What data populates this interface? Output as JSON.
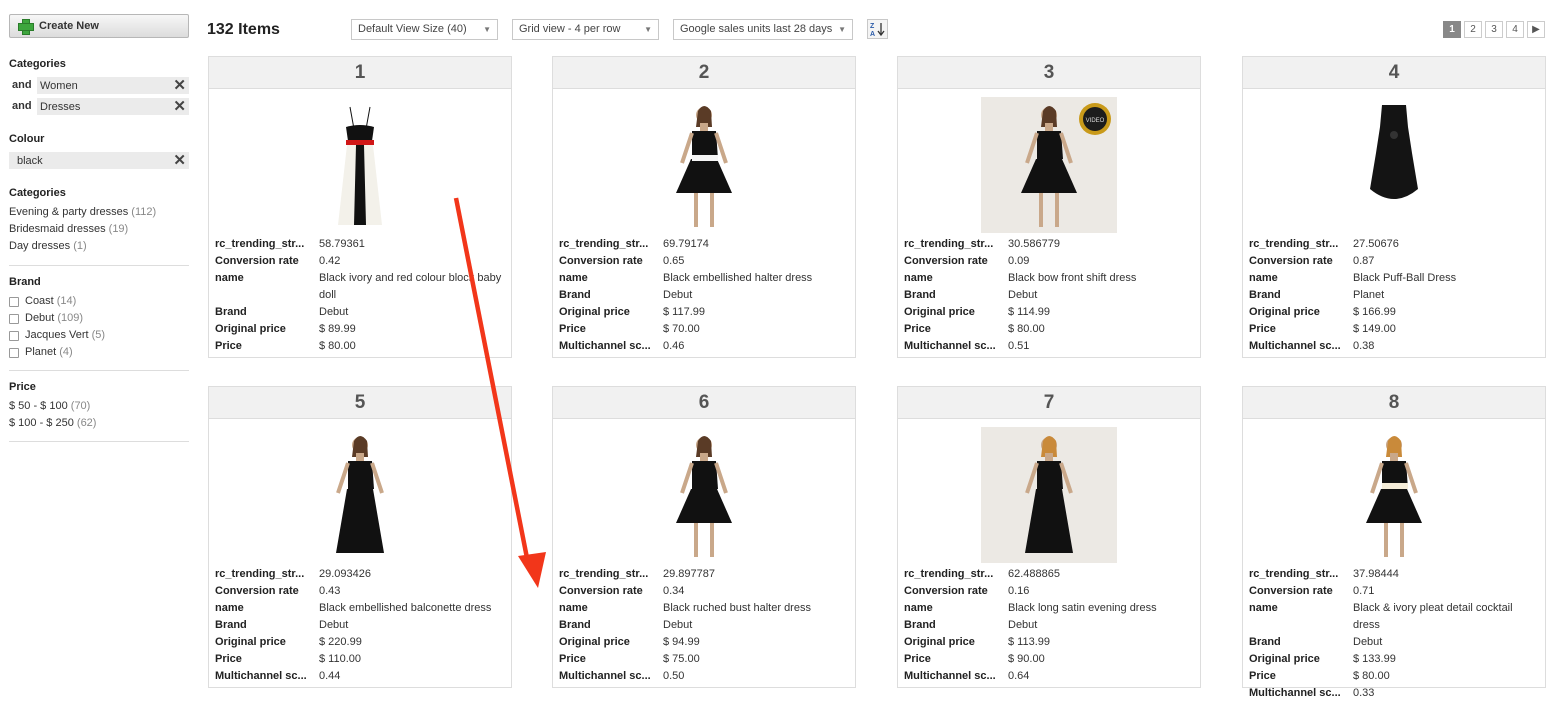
{
  "sidebar": {
    "create_label": "Create New",
    "active_filters": {
      "categories_heading": "Categories",
      "categories": [
        {
          "op": "and",
          "value": "Women"
        },
        {
          "op": "and",
          "value": "Dresses"
        }
      ],
      "colour_heading": "Colour",
      "colour": "black"
    },
    "categories": {
      "heading": "Categories",
      "items": [
        {
          "label": "Evening & party dresses",
          "count": "(112)"
        },
        {
          "label": "Bridesmaid dresses",
          "count": "(19)"
        },
        {
          "label": "Day dresses",
          "count": "(1)"
        }
      ]
    },
    "brand": {
      "heading": "Brand",
      "items": [
        {
          "label": "Coast",
          "count": "(14)"
        },
        {
          "label": "Debut",
          "count": "(109)"
        },
        {
          "label": "Jacques Vert",
          "count": "(5)"
        },
        {
          "label": "Planet",
          "count": "(4)"
        }
      ]
    },
    "price": {
      "heading": "Price",
      "items": [
        {
          "label": "$ 50 - $ 100",
          "count": "(70)"
        },
        {
          "label": "$ 100 - $ 250",
          "count": "(62)"
        }
      ]
    }
  },
  "toolbar": {
    "item_count": "132 Items",
    "view_size": "Default View Size (40)",
    "grid_view": "Grid view - 4 per row",
    "sort_by": "Google sales units last 28 days",
    "sort_icon": "sort-z-a-icon",
    "pages": [
      "1",
      "2",
      "3",
      "4"
    ],
    "next_icon": "next-page-icon"
  },
  "attr_labels": [
    "rc_trending_str...",
    "Conversion rate",
    "name",
    "Brand",
    "Original price",
    "Price",
    "Multichannel sc..."
  ],
  "products": [
    {
      "rank": "1",
      "trending": "58.79361",
      "conversion": "0.42",
      "name": "Black ivory and red colour block baby doll",
      "brand": "Debut",
      "original_price": "$ 89.99",
      "price": "$ 80.00",
      "multichannel": ""
    },
    {
      "rank": "2",
      "trending": "69.79174",
      "conversion": "0.65",
      "name": "Black embellished halter dress",
      "brand": "Debut",
      "original_price": "$ 117.99",
      "price": "$ 70.00",
      "multichannel": "0.46"
    },
    {
      "rank": "3",
      "trending": "30.586779",
      "conversion": "0.09",
      "name": "Black bow front shift dress",
      "brand": "Debut",
      "original_price": "$ 114.99",
      "price": "$ 80.00",
      "multichannel": "0.51",
      "badge": "VIDEO"
    },
    {
      "rank": "4",
      "trending": "27.50676",
      "conversion": "0.87",
      "name": "Black Puff-Ball Dress",
      "brand": "Planet",
      "original_price": "$ 166.99",
      "price": "$ 149.00",
      "multichannel": "0.38"
    },
    {
      "rank": "5",
      "trending": "29.093426",
      "conversion": "0.43",
      "name": "Black embellished balconette dress",
      "brand": "Debut",
      "original_price": "$ 220.99",
      "price": "$ 110.00",
      "multichannel": "0.44"
    },
    {
      "rank": "6",
      "trending": "29.897787",
      "conversion": "0.34",
      "name": "Black ruched bust halter dress",
      "brand": "Debut",
      "original_price": "$ 94.99",
      "price": "$ 75.00",
      "multichannel": "0.50"
    },
    {
      "rank": "7",
      "trending": "62.488865",
      "conversion": "0.16",
      "name": "Black long satin evening dress",
      "brand": "Debut",
      "original_price": "$ 113.99",
      "price": "$ 90.00",
      "multichannel": "0.64"
    },
    {
      "rank": "8",
      "trending": "37.98444",
      "conversion": "0.71",
      "name": "Black & ivory pleat detail cocktail dress",
      "brand": "Debut",
      "original_price": "$ 133.99",
      "price": "$ 80.00",
      "multichannel": "0.33"
    }
  ],
  "colors": {
    "annotation_arrow": "#f2361a",
    "page_active": "#888888",
    "create_icon": "#3da63d"
  }
}
